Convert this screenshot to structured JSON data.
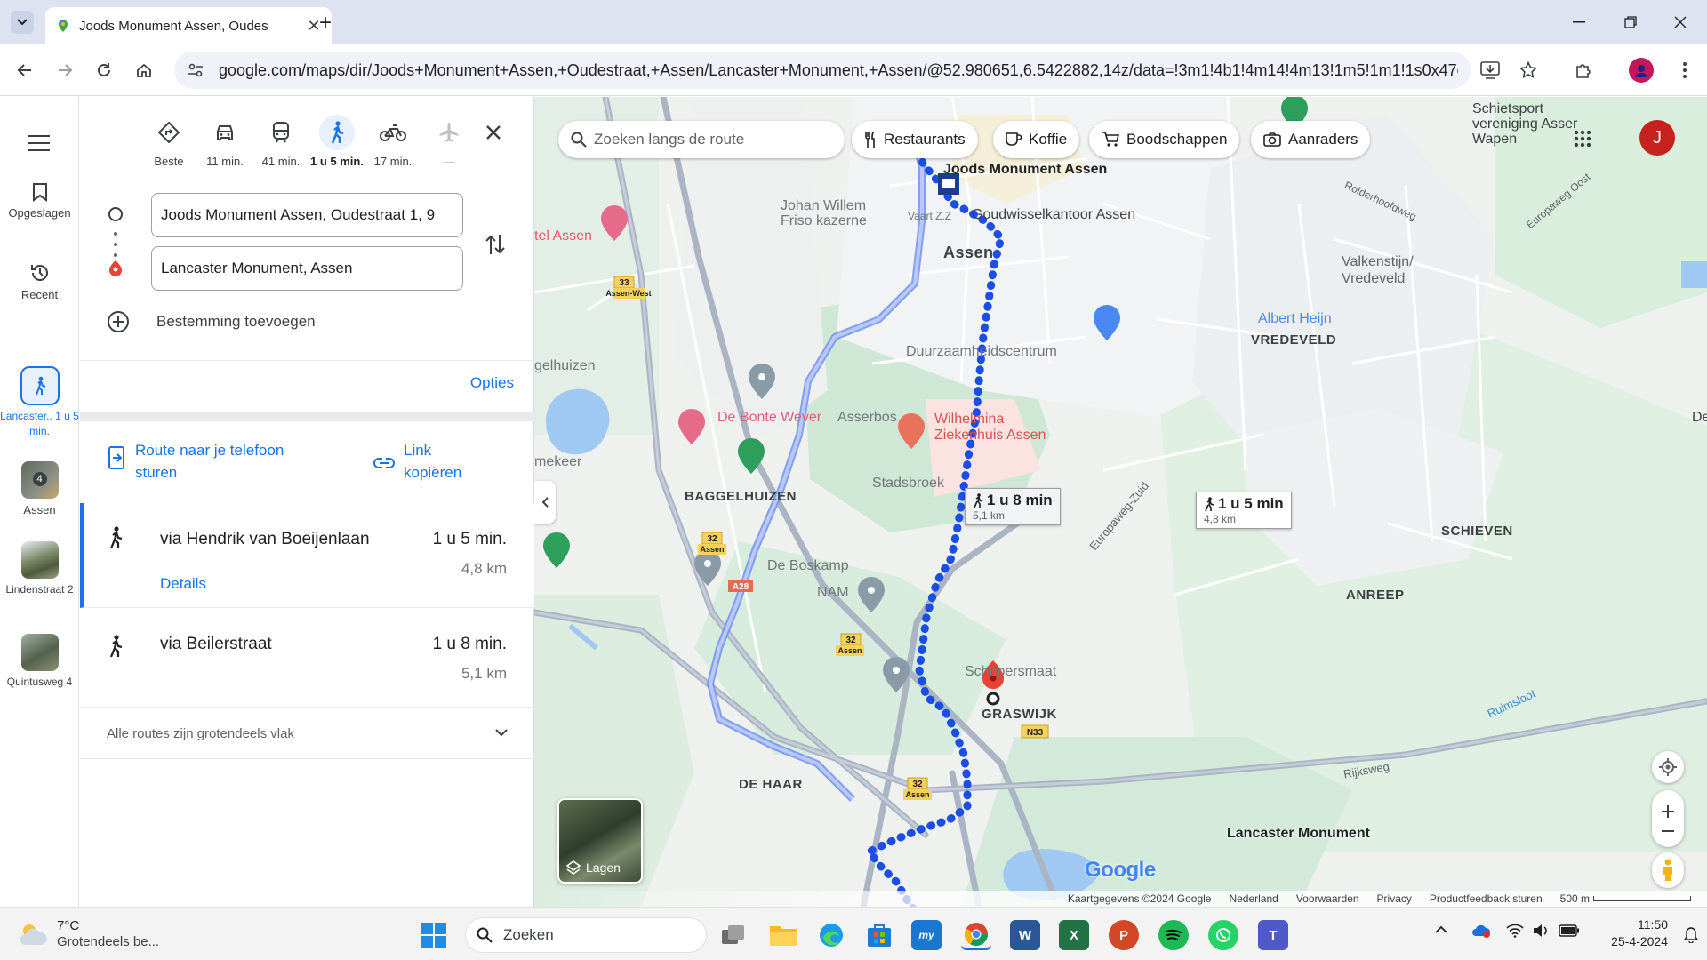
{
  "browser": {
    "tab_title": "Joods Monument Assen, Oudes",
    "new_tab": "+",
    "url": "google.com/maps/dir/Joods+Monument+Assen,+Oudestraat,+Assen/Lancaster+Monument,+Assen/@52.980651,6.5422882,14z/data=!3m1!4b1!4m14!4m13!1m5!1m1!1s0x47c8251...",
    "profile_initial": ""
  },
  "rail": {
    "saved": "Opgeslagen",
    "recent": "Recent",
    "active_label": "Lancaster.. 1 u 5 min.",
    "items": [
      {
        "label": "Assen",
        "badge": "4"
      },
      {
        "label": "Lindenstraat 2"
      },
      {
        "label": "Quintusweg 4"
      }
    ]
  },
  "modes": [
    {
      "name": "Beste",
      "icon": "best-route-icon"
    },
    {
      "name": "11 min.",
      "icon": "car-icon"
    },
    {
      "name": "41 min.",
      "icon": "transit-icon"
    },
    {
      "name": "1 u 5 min.",
      "icon": "walk-icon",
      "active": true
    },
    {
      "name": "17 min.",
      "icon": "bike-icon"
    },
    {
      "name": "—",
      "icon": "flight-icon"
    }
  ],
  "directions": {
    "origin": "Joods Monument Assen, Oudestraat 1, 9",
    "destination": "Lancaster Monument, Assen",
    "add_destination": "Bestemming toevoegen",
    "options": "Opties",
    "send_to_phone": "Route naar je telefoon sturen",
    "copy_link": "Link kopiëren",
    "routes": [
      {
        "via": "via Hendrik van Boeijenlaan",
        "duration": "1 u 5 min.",
        "distance": "4,8 km",
        "details": "Details"
      },
      {
        "via": "via Beilerstraat",
        "duration": "1 u 8 min.",
        "distance": "5,1 km"
      }
    ],
    "footer": "Alle routes zijn grotendeels vlak"
  },
  "map": {
    "search_placeholder": "Zoeken langs de route",
    "chips": [
      "Restaurants",
      "Koffie",
      "Boodschappen",
      "Aanraders"
    ],
    "account_initial": "J",
    "origin_label": "Joods Monument Assen",
    "destination_label": "Lancaster Monument",
    "callout_main": {
      "time": "1 u 5 min",
      "dist": "4,8 km"
    },
    "callout_alt": {
      "time": "1 u 8 min",
      "dist": "5,1 km"
    },
    "places": [
      "Goudwisselkantoor Assen",
      "Assen",
      "Johan Willem Friso kazerne",
      "Vaart Z.Z",
      "Valkenstijn/ Vredeveld",
      "Albert Heijn",
      "VREDEVELD",
      "Duurzaamheidscentrum",
      "Asserbos",
      "De Bonte Wever",
      "Wilhelmina Ziekenhuis Assen",
      "Stadsbroek",
      "BAGGELHUIZEN",
      "De Boskamp",
      "SCHIEVEN",
      "ANREEP",
      "NAM",
      "Schepersmaat",
      "GRASWIJK",
      "DE HAAR",
      "Rijksweg",
      "Europaweg-Zuid",
      "Ruimsloot",
      "Rolderhoofdweg",
      "Schietsport vereniging Asser Wapen",
      "tel Assen",
      "gelhuizen",
      "mekeer",
      "Europaweg Oost",
      "De"
    ],
    "shields": [
      "33",
      "Assen-West",
      "32",
      "Assen",
      "A28",
      "32",
      "Assen",
      "N33",
      "32",
      "Assen"
    ],
    "layers": "Lagen",
    "logo": "Google",
    "attribution": [
      "Kaartgegevens ©2024 Google",
      "Nederland",
      "Voorwaarden",
      "Privacy",
      "Productfeedback sturen",
      "500 m"
    ]
  },
  "taskbar": {
    "weather_temp": "7°C",
    "weather_desc": "Grotendeels be...",
    "search": "Zoeken",
    "time": "11:50",
    "date": "25-4-2024"
  }
}
